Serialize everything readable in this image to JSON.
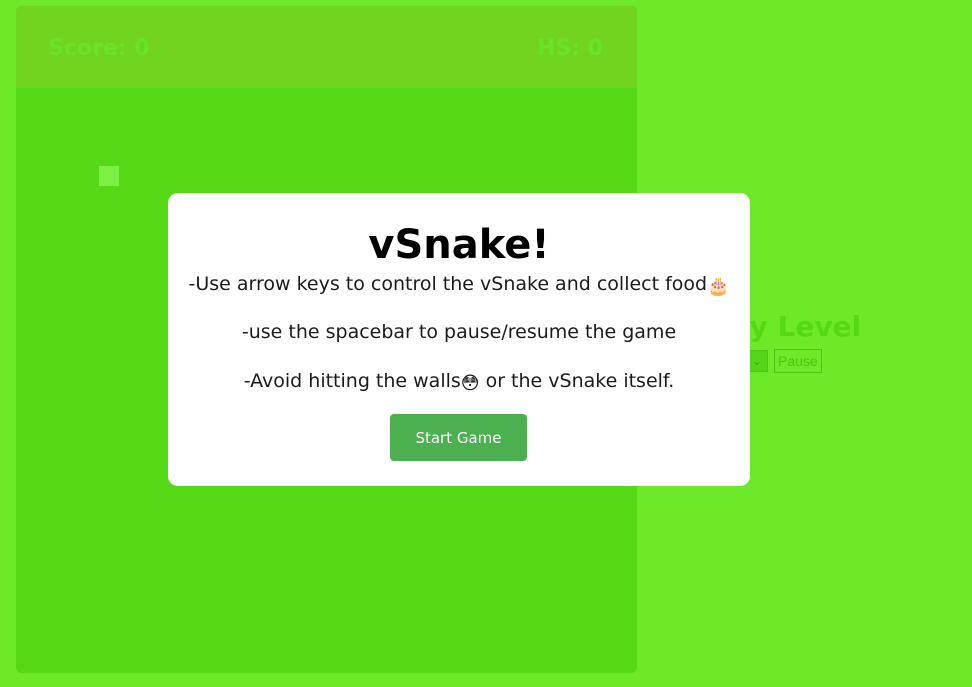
{
  "game": {
    "score_label": "Score: 0",
    "high_score_label": "HS: 0"
  },
  "side_panel": {
    "difficulty_title": "culty Level",
    "select_arrow": "⌄",
    "pause_label": "Pause"
  },
  "modal": {
    "title": "vSnake!",
    "instruction_1": "-Use arrow keys to control the vSnake and collect food",
    "instruction_1_emoji": "🎂",
    "instruction_2": "-use the spacebar to pause/resume the game",
    "instruction_3_before": "-Avoid hitting the walls",
    "instruction_3_emoji": "😳",
    "instruction_3_after": " or the vSnake itself.",
    "start_button_label": "Start Game"
  },
  "colors": {
    "page_background": "#6ee92a",
    "board_background": "#55d916",
    "scorebar_background": "#71d41e",
    "button_green": "#4caf50",
    "modal_background": "#ffffff"
  }
}
